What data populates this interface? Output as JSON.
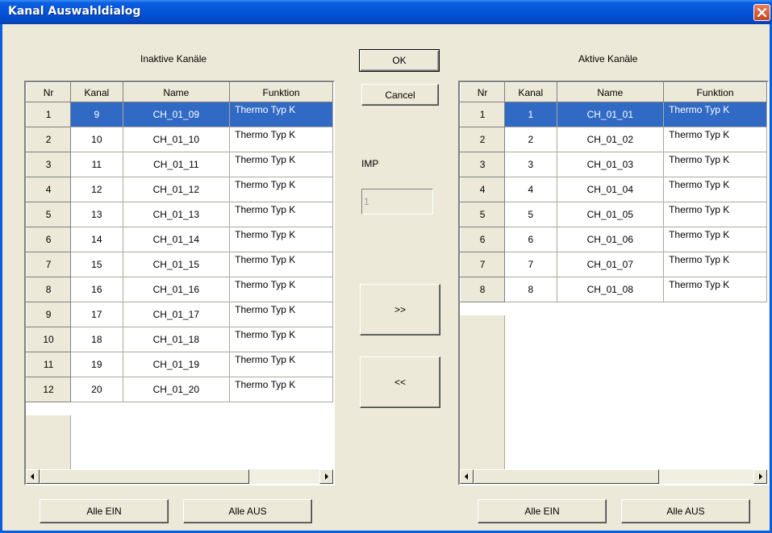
{
  "window": {
    "title": "Kanal Auswahldialog"
  },
  "inactive": {
    "label": "Inaktive Kanäle",
    "headers": [
      "Nr",
      "Kanal",
      "Name",
      "Funktion"
    ],
    "rows": [
      [
        "1",
        "9",
        "CH_01_09",
        "Thermo Typ K"
      ],
      [
        "2",
        "10",
        "CH_01_10",
        "Thermo Typ K"
      ],
      [
        "3",
        "11",
        "CH_01_11",
        "Thermo Typ K"
      ],
      [
        "4",
        "12",
        "CH_01_12",
        "Thermo Typ K"
      ],
      [
        "5",
        "13",
        "CH_01_13",
        "Thermo Typ K"
      ],
      [
        "6",
        "14",
        "CH_01_14",
        "Thermo Typ K"
      ],
      [
        "7",
        "15",
        "CH_01_15",
        "Thermo Typ K"
      ],
      [
        "8",
        "16",
        "CH_01_16",
        "Thermo Typ K"
      ],
      [
        "9",
        "17",
        "CH_01_17",
        "Thermo Typ K"
      ],
      [
        "10",
        "18",
        "CH_01_18",
        "Thermo Typ K"
      ],
      [
        "11",
        "19",
        "CH_01_19",
        "Thermo Typ K"
      ],
      [
        "12",
        "20",
        "CH_01_20",
        "Thermo Typ K"
      ]
    ],
    "selected_row": 0,
    "all_on": "Alle EIN",
    "all_off": "Alle AUS"
  },
  "active": {
    "label": "Aktive Kanäle",
    "headers": [
      "Nr",
      "Kanal",
      "Name",
      "Funktion"
    ],
    "rows": [
      [
        "1",
        "1",
        "CH_01_01",
        "Thermo Typ K"
      ],
      [
        "2",
        "2",
        "CH_01_02",
        "Thermo Typ K"
      ],
      [
        "3",
        "3",
        "CH_01_03",
        "Thermo Typ K"
      ],
      [
        "4",
        "4",
        "CH_01_04",
        "Thermo Typ K"
      ],
      [
        "5",
        "5",
        "CH_01_05",
        "Thermo Typ K"
      ],
      [
        "6",
        "6",
        "CH_01_06",
        "Thermo Typ K"
      ],
      [
        "7",
        "7",
        "CH_01_07",
        "Thermo Typ K"
      ],
      [
        "8",
        "8",
        "CH_01_08",
        "Thermo Typ K"
      ]
    ],
    "selected_row": 0,
    "all_on": "Alle EIN",
    "all_off": "Alle AUS"
  },
  "buttons": {
    "ok": "OK",
    "cancel": "Cancel",
    "move_right": ">>",
    "move_left": "<<"
  },
  "imp": {
    "label": "IMP",
    "value": "1"
  },
  "colors": {
    "selection": "#316ac5",
    "titlebar": "#0553d8",
    "dialog_bg": "#ece9d8"
  },
  "icons": {
    "close": "close-icon",
    "scroll_left": "arrow-left-icon",
    "scroll_right": "arrow-right-icon"
  }
}
